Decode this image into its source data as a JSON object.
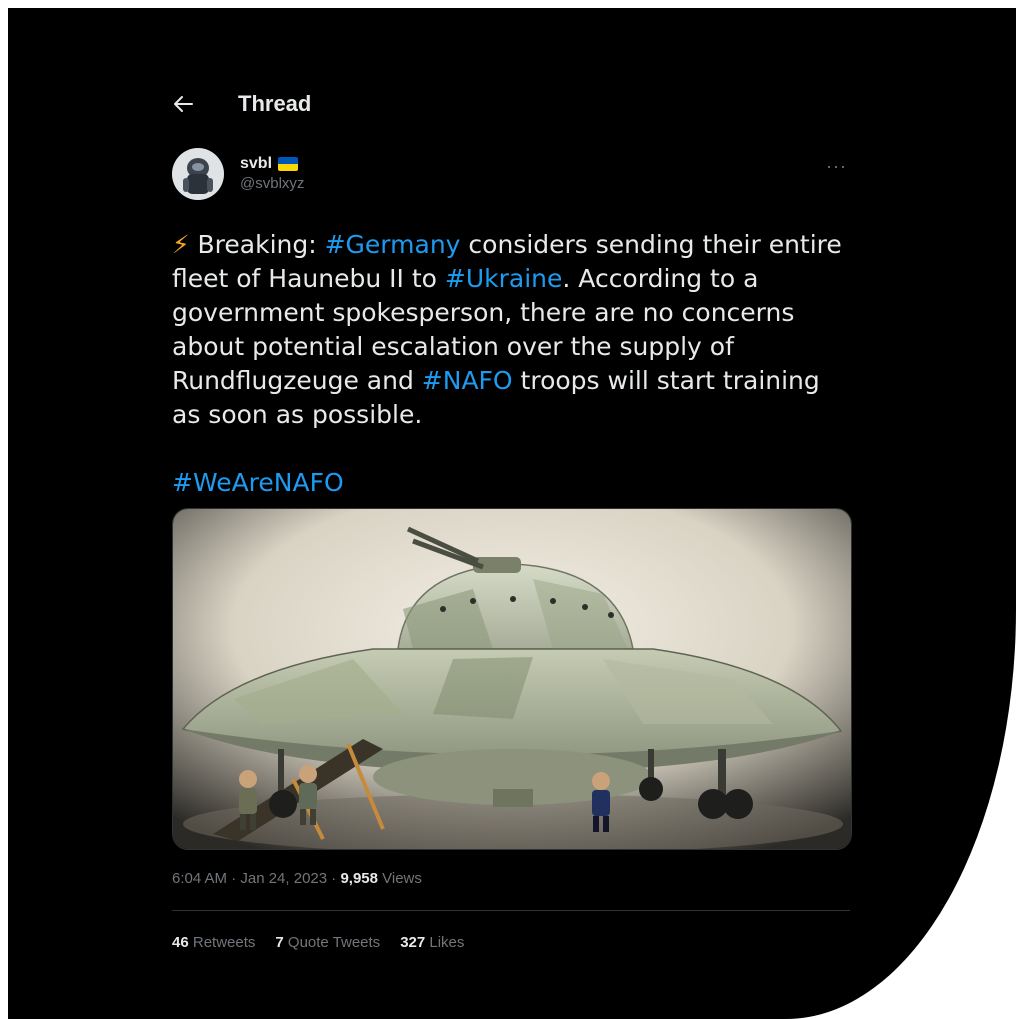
{
  "header": {
    "title": "Thread",
    "back_icon": "arrow-left-icon"
  },
  "author": {
    "display_name": "svbl",
    "handle": "@svblxyz",
    "flag_icon": "ukraine-flag-icon",
    "flag_colors": [
      "#0057b7",
      "#ffd700"
    ]
  },
  "more_icon": "ellipsis-icon",
  "tweet": {
    "bolt": "⚡",
    "breaking": " Breaking: ",
    "tag_germany": "#Germany",
    "seg1": " considers sending their entire fleet of Haunebu II to ",
    "tag_ukraine": "#Ukraine",
    "seg2": ". According to a government spokesperson, there are no concerns about potential escalation over the supply of Rundflugzeuge and ",
    "tag_nafo": "#NAFO",
    "seg3": " troops will start training as soon as possible.",
    "tag_wearenafo": "#WeAreNAFO"
  },
  "meta": {
    "time": "6:04 AM · Jan 24, 2023 · ",
    "views_count": "9,958",
    "views_label": " Views"
  },
  "stats": [
    {
      "count": "46",
      "label": " Retweets"
    },
    {
      "count": "7",
      "label": " Quote Tweets"
    },
    {
      "count": "327",
      "label": " Likes"
    }
  ],
  "colors": {
    "accent": "#1d9bf0",
    "text": "#e7e9ea",
    "muted": "#71767b",
    "background": "#000000"
  }
}
